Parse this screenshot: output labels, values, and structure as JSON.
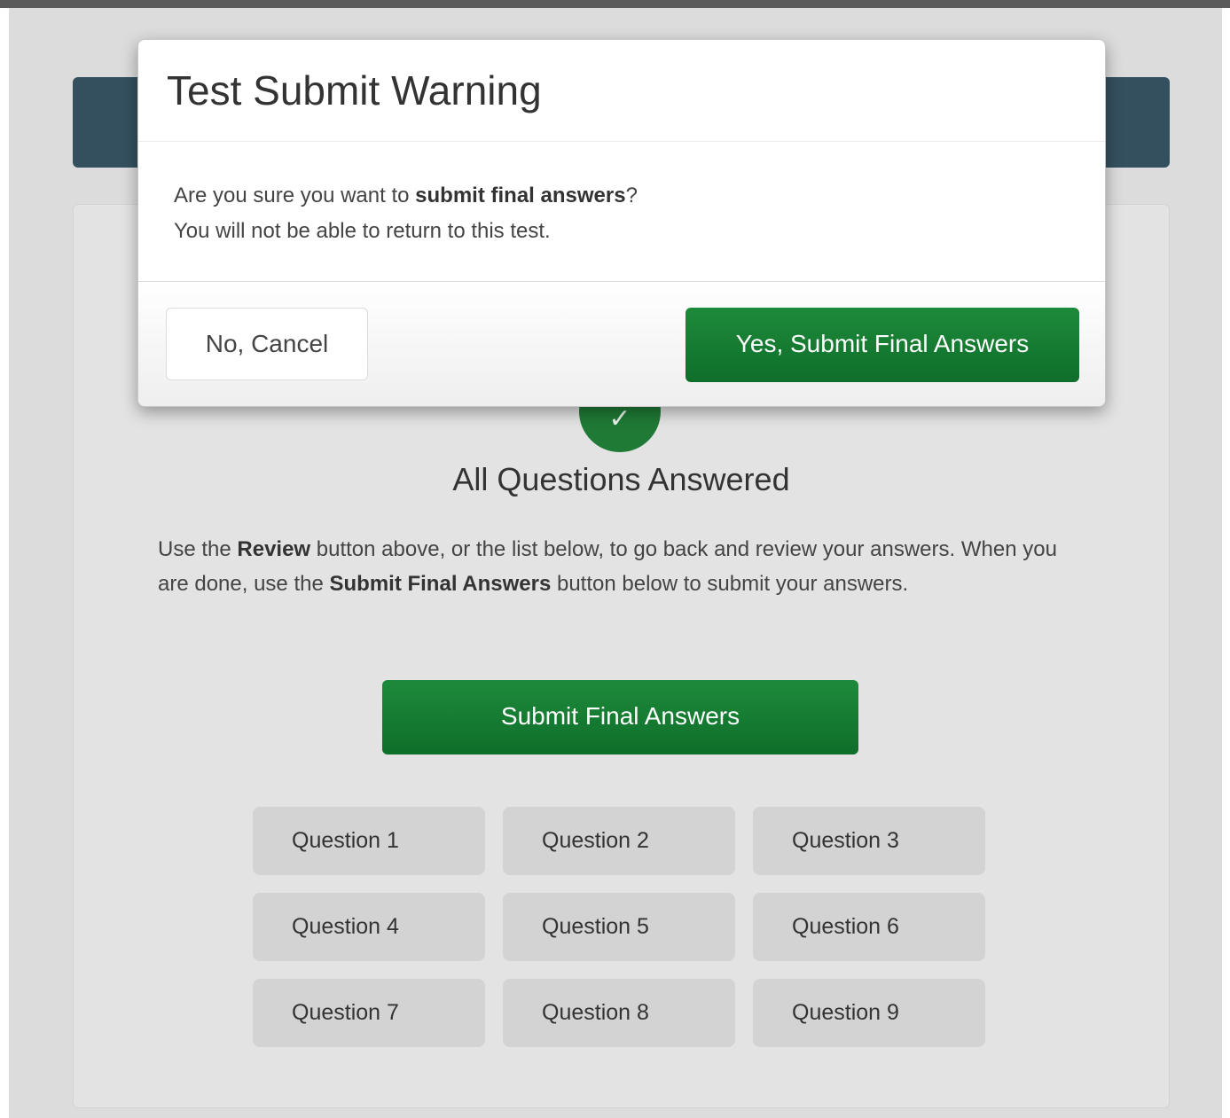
{
  "modal": {
    "title": "Test Submit Warning",
    "body_prefix": "Are you sure you want to ",
    "body_bold": "submit final answers",
    "body_suffix": "?",
    "body_line2": "You will not be able to return to this test.",
    "cancel_label": "No, Cancel",
    "confirm_label": "Yes, Submit Final Answers"
  },
  "status": {
    "check_icon": "check-icon",
    "title": "All Questions Answered"
  },
  "instructions": {
    "part1": "Use the ",
    "bold1": "Review",
    "part2": " button above, or the list below, to go back and review your answers. When you are done, use the ",
    "bold2": "Submit Final Answers",
    "part3": " button below to submit your answers."
  },
  "submit_button_label": "Submit Final Answers",
  "questions": [
    {
      "label": "Question 1"
    },
    {
      "label": "Question 2"
    },
    {
      "label": "Question 3"
    },
    {
      "label": "Question 4"
    },
    {
      "label": "Question 5"
    },
    {
      "label": "Question 6"
    },
    {
      "label": "Question 7"
    },
    {
      "label": "Question 8"
    },
    {
      "label": "Question 9"
    }
  ],
  "colors": {
    "accent_green": "#1a7f36",
    "header_band": "#34505f",
    "backdrop": "#dcdcdc"
  }
}
